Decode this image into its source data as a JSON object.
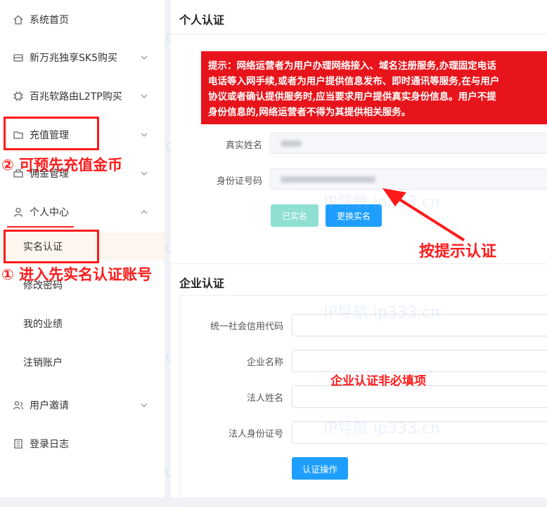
{
  "sidebar": {
    "items": [
      {
        "label": "系统首页",
        "icon": "home-icon"
      },
      {
        "label": "新万兆独享SK5购买",
        "icon": "server-icon"
      },
      {
        "label": "百兆软路由L2TP购买",
        "icon": "chip-icon"
      },
      {
        "label": "充值管理",
        "icon": "wallet-icon"
      },
      {
        "label": "佣金管理",
        "icon": "commission-icon"
      },
      {
        "label": "个人中心",
        "icon": "user-icon"
      }
    ],
    "sub_items": [
      {
        "label": "实名认证"
      },
      {
        "label": "修改密码"
      },
      {
        "label": "我的业绩"
      },
      {
        "label": "注销账户"
      }
    ],
    "bottom_items": [
      {
        "label": "用户邀请",
        "icon": "invite-icon"
      },
      {
        "label": "登录日志",
        "icon": "log-icon"
      }
    ]
  },
  "personal": {
    "title": "个人认证",
    "notice_lines": [
      "提示：网络运营者为用户办理网络接入、域名注册服务,办理固定电话",
      "电话等入网手续,或者为用户提供信息发布、即时通讯等服务,在与用户",
      "协议或者确认提供服务时,应当要求用户提供真实身份信息。用户不提",
      "身份信息的,网络运营者不得为其提供相关服务。"
    ],
    "name_label": "真实姓名",
    "id_label": "身份证号码",
    "btn_verified": "已实名",
    "btn_change": "更换实名"
  },
  "enterprise": {
    "title": "企业认证",
    "fields": [
      {
        "label": "统一社会信用代码"
      },
      {
        "label": "企业名称"
      },
      {
        "label": "法人姓名"
      },
      {
        "label": "法人身份证号"
      }
    ],
    "submit": "认证操作"
  },
  "annotations": {
    "step1": "① 进入先实名认证账号",
    "step2": "② 可预先充值金币",
    "hint": "按提示认证",
    "optional": "企业认证非必填项"
  },
  "watermark": "IP导航  ip333.cn",
  "colors": {
    "accent": "#1e9fff",
    "annotation": "#ff1a1a",
    "notice_bg": "#e8141b",
    "verified": "#8fe0d3"
  }
}
